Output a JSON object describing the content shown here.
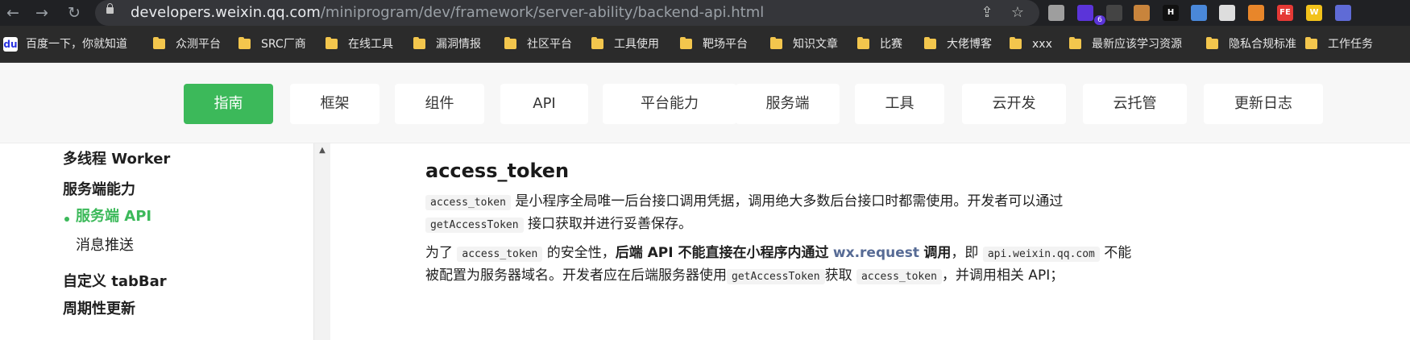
{
  "browser": {
    "url_host": "developers.weixin.qq.com",
    "url_path": "/miniprogram/dev/framework/server-ability/backend-api.html",
    "icons": [
      "back-icon",
      "forward-icon",
      "reload-icon",
      "lock-icon",
      "share-icon",
      "star-icon"
    ],
    "extension_badge": "6",
    "extensions": [
      {
        "name": "circle-extension-icon",
        "text": "",
        "color": "#9e9e9e"
      },
      {
        "name": "stack-extension-icon",
        "text": "",
        "color": "#5b34d9"
      },
      {
        "name": "hat-extension-icon",
        "text": "",
        "color": "#444444"
      },
      {
        "name": "cookie-extension-icon",
        "text": "",
        "color": "#c8843c"
      },
      {
        "name": "h-extension-icon",
        "text": "H",
        "color": "#111111"
      },
      {
        "name": "pin-extension-icon",
        "text": "",
        "color": "#4a88d9"
      },
      {
        "name": "robot-extension-icon",
        "text": "",
        "color": "#dddddd"
      },
      {
        "name": "arrow-extension-icon",
        "text": "",
        "color": "#e8862a"
      },
      {
        "name": "fe-extension-icon",
        "text": "FE",
        "color": "#e53935"
      },
      {
        "name": "w-extension-icon",
        "text": "W",
        "color": "#f2c21b"
      },
      {
        "name": "person-extension-icon",
        "text": "",
        "color": "#5f6bd6"
      }
    ]
  },
  "bookmarks": [
    {
      "label": "百度一下，你就知道",
      "icon": "baidu-icon"
    },
    {
      "label": "众测平台",
      "icon": "folder-icon"
    },
    {
      "label": "SRC厂商",
      "icon": "folder-icon"
    },
    {
      "label": "在线工具",
      "icon": "folder-icon"
    },
    {
      "label": "漏洞情报",
      "icon": "folder-icon"
    },
    {
      "label": "社区平台",
      "icon": "folder-icon"
    },
    {
      "label": "工具使用",
      "icon": "folder-icon"
    },
    {
      "label": "靶场平台",
      "icon": "folder-icon"
    },
    {
      "label": "知识文章",
      "icon": "folder-icon"
    },
    {
      "label": "比赛",
      "icon": "folder-icon"
    },
    {
      "label": "大佬博客",
      "icon": "folder-icon"
    },
    {
      "label": "xxx",
      "icon": "folder-icon"
    },
    {
      "label": "最新应该学习资源",
      "icon": "folder-icon"
    },
    {
      "label": "隐私合规标准",
      "icon": "folder-icon"
    },
    {
      "label": "工作任务",
      "icon": "folder-icon"
    }
  ],
  "nav": {
    "tabs": [
      "指南",
      "框架",
      "组件",
      "API",
      "平台能力",
      "服务端",
      "工具",
      "云开发",
      "云托管",
      "更新日志"
    ],
    "active": "指南"
  },
  "sidebar": {
    "items": [
      {
        "label": "多线程 Worker"
      },
      {
        "label": "服务端能力"
      },
      {
        "label": "服务端 API"
      },
      {
        "label": "消息推送"
      },
      {
        "label": "自定义 tabBar"
      },
      {
        "label": "周期性更新"
      }
    ],
    "active": "服务端 API"
  },
  "content": {
    "heading": "access_token",
    "p1": {
      "code1": "access_token",
      "text1": "是小程序全局唯一后台接口调用凭据，调用绝大多数后台接口时都需使用。开发者可以通过",
      "code2": "getAccessToken",
      "text2": "接口获取并进行妥善保存。"
    },
    "p2": {
      "text1": "为了",
      "code1": "access_token",
      "text2": "的安全性，",
      "strong1": "后端 API 不能直接在小程序内通过",
      "link": "wx.request",
      "strong2": "调用",
      "text3": "，即",
      "code2": "api.weixin.qq.com",
      "text4": "不能",
      "text5": "被配置为服务器域名。开发者应在后端服务器使用",
      "code3": "getAccessToken",
      "text6": "获取",
      "code4": "access_token",
      "text7": "，并调用相关 API；"
    }
  },
  "colors": {
    "accent": "#3cb95a",
    "link": "#576b95",
    "browser_bg": "#202124",
    "bookmark_bar": "#2b2b2b"
  }
}
